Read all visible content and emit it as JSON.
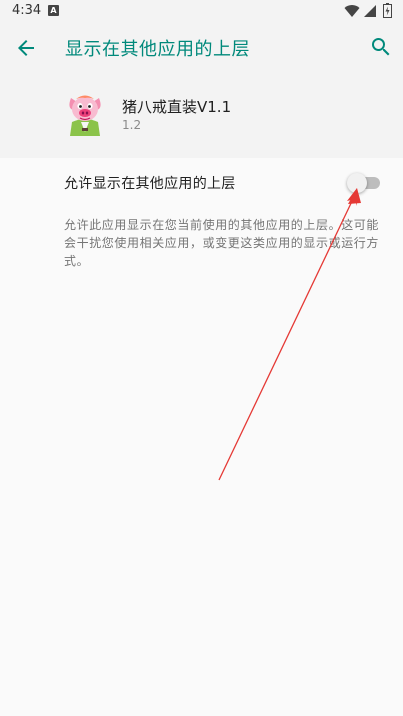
{
  "status_bar": {
    "time": "4:34",
    "notification_letter": "A",
    "icons": [
      "wifi-icon",
      "signal-icon",
      "battery-icon"
    ]
  },
  "toolbar": {
    "title": "显示在其他应用的上层",
    "back_icon": "arrow-back-icon",
    "search_icon": "search-icon"
  },
  "app": {
    "name": "猪八戒直装V1.1",
    "version": "1.2",
    "icon": "pig-app-icon"
  },
  "permission": {
    "label": "允许显示在其他应用的上层",
    "enabled": false,
    "description": "允许此应用显示在您当前使用的其他应用的上层。这可能会干扰您使用相关应用，或变更这类应用的显示或运行方式。"
  },
  "colors": {
    "accent": "#00897b",
    "annotation_arrow": "#e53935",
    "background": "#fafafa",
    "header_background": "#f3f3f3"
  }
}
